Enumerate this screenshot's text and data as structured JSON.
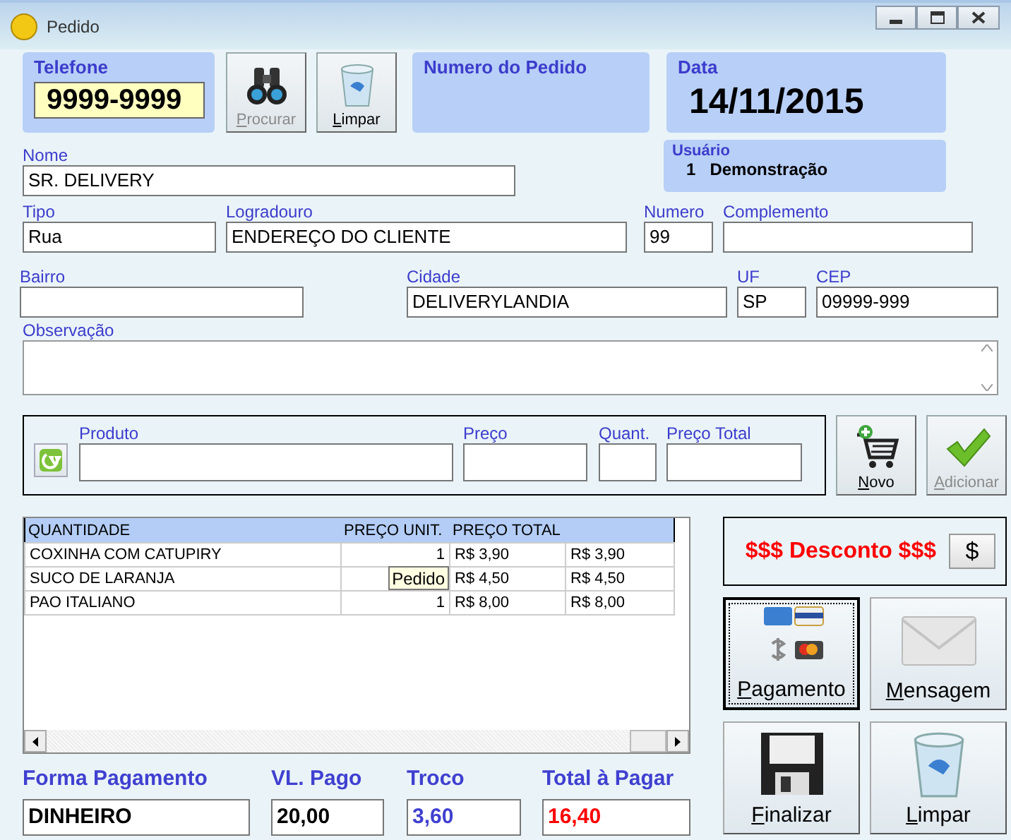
{
  "window": {
    "title": "Pedido"
  },
  "telefone": {
    "label": "Telefone",
    "value": "9999-9999"
  },
  "top_buttons": [
    {
      "label": "Procurar",
      "kind": "binoculars",
      "disabled": true,
      "mnemonic": true
    },
    {
      "label": "Limpar",
      "kind": "trash",
      "disabled": false,
      "mnemonic": true
    }
  ],
  "numero_pedido": {
    "label": "Numero do Pedido"
  },
  "data": {
    "label": "Data",
    "value": "14/11/2015"
  },
  "usuario": {
    "label": "Usuário",
    "code": "1",
    "name": "Demonstração"
  },
  "customer_fields": [
    [
      {
        "label": "Nome",
        "value": "SR. DELIVERY"
      }
    ],
    [
      {
        "label": "Tipo",
        "value": "Rua"
      },
      {
        "label": "Logradouro",
        "value": "ENDEREÇO DO CLIENTE"
      },
      {
        "label": "Numero",
        "value": "99"
      },
      {
        "label": "Complemento"
      }
    ],
    [
      {
        "label": "Bairro"
      },
      {
        "label": "Cidade",
        "value": "DELIVERYLANDIA"
      },
      {
        "label": "UF",
        "value": "SP"
      },
      {
        "label": "CEP",
        "value": "09999-999"
      }
    ]
  ],
  "observacao": {
    "label": "Observação"
  },
  "produto_fields": [
    {
      "label": "Produto"
    },
    {
      "label": "Preço"
    },
    {
      "label": "Quant."
    },
    {
      "label": "Preço Total"
    }
  ],
  "product_buttons": [
    {
      "label": "Novo",
      "kind": "cart",
      "disabled": false,
      "mnemonic": true
    },
    {
      "label": "Adicionar",
      "kind": "check",
      "disabled": true,
      "mnemonic": true
    }
  ],
  "items_table": {
    "columns": [
      "QUANTIDADE",
      "PREÇO UNIT.",
      "PREÇO TOTAL"
    ],
    "rows": [
      {
        "cells": [
          "COXINHA COM CATUPIRY",
          "1",
          "R$ 3,90",
          "R$ 3,90"
        ]
      },
      {
        "cells": [
          "SUCO DE LARANJA",
          null,
          "R$ 4,50",
          "R$ 4,50"
        ]
      },
      {
        "cells": [
          "PAO ITALIANO",
          "1",
          "R$ 8,00",
          "R$ 8,00"
        ]
      }
    ],
    "tooltip": "Pedido"
  },
  "desconto": {
    "label": "$$$ Desconto $$$",
    "button": "$"
  },
  "action_buttons": [
    {
      "label": "Pagamento",
      "kind": "cards",
      "focused": true,
      "mnemonic": true
    },
    {
      "label": "Mensagem",
      "kind": "envelope",
      "focused": false,
      "mnemonic": true
    },
    {
      "label": "Finalizar",
      "kind": "floppy",
      "focused": false,
      "mnemonic": true
    },
    {
      "label": "Limpar",
      "kind": "trash",
      "focused": false,
      "mnemonic": true
    }
  ],
  "totals": [
    {
      "label": "Forma Pagamento",
      "value": "DINHEIRO",
      "color": "#000000"
    },
    {
      "label": "VL. Pago",
      "value": "20,00",
      "color": "#000000"
    },
    {
      "label": "Troco",
      "value": "3,60",
      "color": "#4040d0"
    },
    {
      "label": "Total à Pagar",
      "value": "16,40",
      "color": "#ff0000"
    }
  ]
}
